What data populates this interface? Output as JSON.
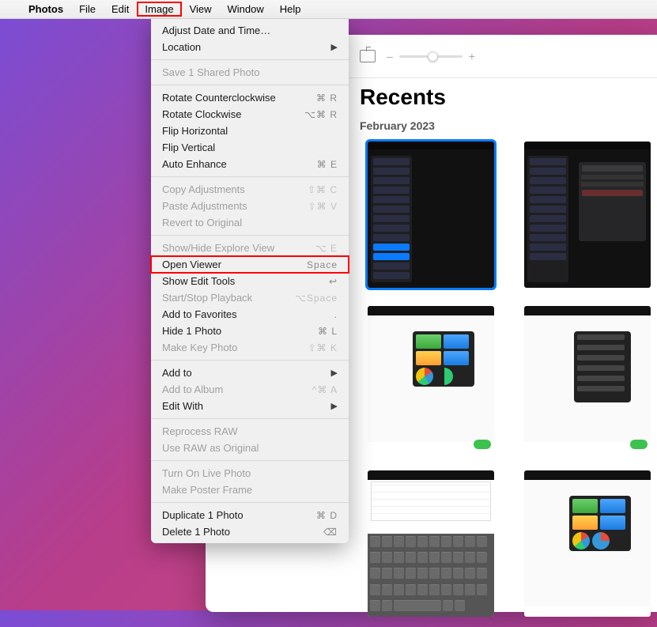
{
  "menubar": {
    "app": "Photos",
    "items": [
      "File",
      "Edit",
      "Image",
      "View",
      "Window",
      "Help"
    ],
    "highlighted": "Image"
  },
  "dropdown": {
    "groups": [
      [
        {
          "label": "Adjust Date and Time…",
          "enabled": true
        },
        {
          "label": "Location",
          "enabled": true,
          "submenu": true
        }
      ],
      [
        {
          "label": "Save 1 Shared Photo",
          "enabled": false
        }
      ],
      [
        {
          "label": "Rotate Counterclockwise",
          "enabled": true,
          "shortcut": "⌘ R"
        },
        {
          "label": "Rotate Clockwise",
          "enabled": true,
          "shortcut": "⌥⌘ R"
        },
        {
          "label": "Flip Horizontal",
          "enabled": true
        },
        {
          "label": "Flip Vertical",
          "enabled": true
        },
        {
          "label": "Auto Enhance",
          "enabled": true,
          "shortcut": "⌘ E"
        }
      ],
      [
        {
          "label": "Copy Adjustments",
          "enabled": false,
          "shortcut": "⇧⌘ C"
        },
        {
          "label": "Paste Adjustments",
          "enabled": false,
          "shortcut": "⇧⌘ V"
        },
        {
          "label": "Revert to Original",
          "enabled": false
        }
      ],
      [
        {
          "label": "Show/Hide Explore View",
          "enabled": false,
          "shortcut": "⌥ E"
        },
        {
          "label": "Open Viewer",
          "enabled": true,
          "shortcut": "Space",
          "highlight": true
        },
        {
          "label": "Show Edit Tools",
          "enabled": true,
          "shortcut": "↩"
        },
        {
          "label": "Start/Stop Playback",
          "enabled": false,
          "shortcut": "⌥Space"
        },
        {
          "label": "Add to Favorites",
          "enabled": true,
          "shortcut": "."
        },
        {
          "label": "Hide 1 Photo",
          "enabled": true,
          "shortcut": "⌘ L"
        },
        {
          "label": "Make Key Photo",
          "enabled": false,
          "shortcut": "⇧⌘ K"
        }
      ],
      [
        {
          "label": "Add to",
          "enabled": true,
          "submenu": true
        },
        {
          "label": "Add to Album",
          "enabled": false,
          "shortcut": "^⌘ A"
        },
        {
          "label": "Edit With",
          "enabled": true,
          "submenu": true
        }
      ],
      [
        {
          "label": "Reprocess RAW",
          "enabled": false
        },
        {
          "label": "Use RAW as Original",
          "enabled": false
        }
      ],
      [
        {
          "label": "Turn On Live Photo",
          "enabled": false
        },
        {
          "label": "Make Poster Frame",
          "enabled": false
        }
      ],
      [
        {
          "label": "Duplicate 1 Photo",
          "enabled": true,
          "shortcut": "⌘ D"
        },
        {
          "label": "Delete 1 Photo",
          "enabled": true,
          "shortcut": "⌫"
        }
      ]
    ]
  },
  "photos": {
    "title": "Recents",
    "date": "February 2023",
    "slider": {
      "minus": "–",
      "plus": "+"
    },
    "thumbs": [
      {
        "type": "settings-dark",
        "selected": true
      },
      {
        "type": "settings-dark-panel",
        "selected": false
      },
      {
        "type": "sheet-charts-popup",
        "selected": false
      },
      {
        "type": "sheet-dark-popup",
        "selected": false
      },
      {
        "type": "sheet-keyboard",
        "selected": false
      },
      {
        "type": "sheet-charts-popup-2",
        "selected": false
      }
    ]
  }
}
